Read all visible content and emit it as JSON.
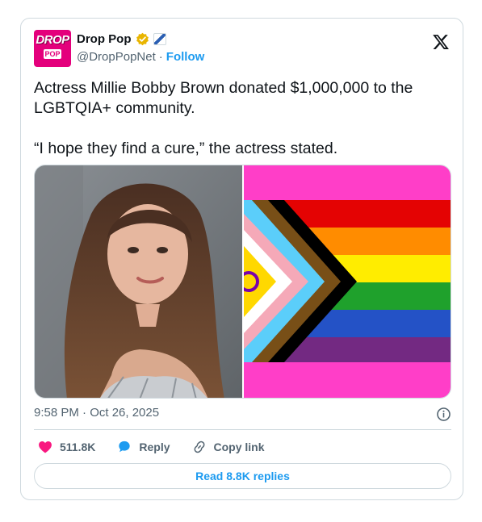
{
  "tweet": {
    "author": {
      "display_name": "Drop Pop",
      "handle": "@DropPopNet",
      "separator": "·",
      "follow_label": "Follow",
      "avatar_text_top": "DROP",
      "avatar_text_bottom": "POP",
      "verified_color": "#e9b500"
    },
    "text": [
      "Actress Millie Bobby Brown donated $1,000,000 to the LGBTQIA+ community.",
      "“I hope they find a cure,” the actress stated."
    ],
    "media": [
      {
        "icon": "portrait-photo"
      },
      {
        "icon": "progress-pride-flag"
      }
    ],
    "timestamp": "9:58 PM · Oct 26, 2025",
    "actions": {
      "likes_count": "511.8K",
      "reply_label": "Reply",
      "copy_link_label": "Copy link"
    },
    "replies_button_label": "Read 8.8K replies"
  },
  "colors": {
    "accent": "#1d9bf0",
    "like": "#f91880",
    "text": "#0f1419",
    "secondary": "#536471",
    "border": "#cfd9de"
  }
}
